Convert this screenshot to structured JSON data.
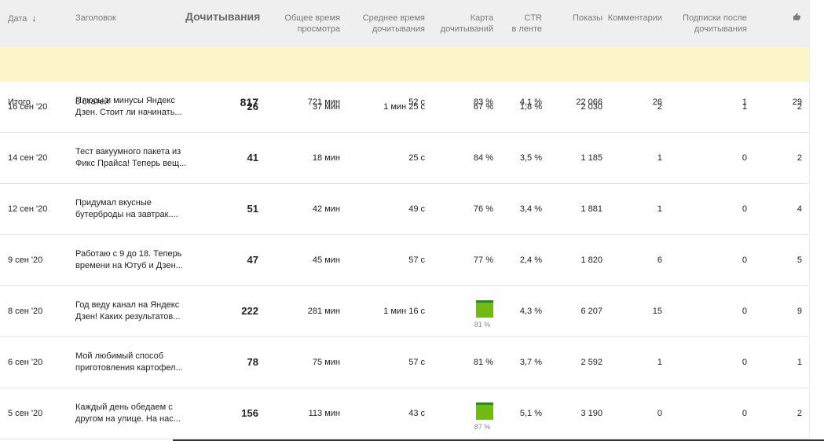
{
  "header": {
    "date": "Дата",
    "sort_arrow": "↓",
    "title": "Заголовок",
    "reads": "Дочитывания",
    "total_time_1": "Общее время",
    "total_time_2": "просмотра",
    "avg_time_1": "Среднее время",
    "avg_time_2": "дочитывания",
    "map_1": "Карта",
    "map_2": "дочитываний",
    "ctr_1": "CTR",
    "ctr_2": "в ленте",
    "shows": "Показы",
    "comments": "Комментарии",
    "subs_1": "Подписки после",
    "subs_2": "дочитывания",
    "likes_icon": "thumbs-up-icon"
  },
  "total": {
    "date": "Итого",
    "title": "8 статей",
    "reads": "817",
    "total_time": "721 мин",
    "avg_time": "52 с",
    "map": "83 %",
    "ctr": "4,1 %",
    "shows": "22 066",
    "comments": "26",
    "subs": "1",
    "likes": "29"
  },
  "rows": [
    {
      "date": "16 сен '20",
      "title_1": "Плюсы и минусы Яндекс",
      "title_2": "Дзен. Стоит ли начинать...",
      "reads": "26",
      "total_time": "37 мин",
      "avg_time": "1 мин 25 с",
      "map": "67 %",
      "map_bar": false,
      "ctr": "1,8 %",
      "shows": "2 030",
      "comments": "2",
      "subs": "1",
      "likes": "2"
    },
    {
      "date": "14 сен '20",
      "title_1": "Тест вакуумного пакета из",
      "title_2": "Фикс Прайса! Теперь вещ...",
      "reads": "41",
      "total_time": "18 мин",
      "avg_time": "25 с",
      "map": "84 %",
      "map_bar": false,
      "ctr": "3,5 %",
      "shows": "1 185",
      "comments": "1",
      "subs": "0",
      "likes": "2"
    },
    {
      "date": "12 сен '20",
      "title_1": "Придумал вкусные",
      "title_2": "бутерброды на завтрак....",
      "reads": "51",
      "total_time": "42 мин",
      "avg_time": "49 с",
      "map": "76 %",
      "map_bar": false,
      "ctr": "3,4 %",
      "shows": "1 881",
      "comments": "1",
      "subs": "0",
      "likes": "4"
    },
    {
      "date": "9 сен '20",
      "title_1": "Работаю с 9 до 18. Теперь",
      "title_2": "времени на Ютуб и Дзен...",
      "reads": "47",
      "total_time": "45 мин",
      "avg_time": "57 с",
      "map": "77 %",
      "map_bar": false,
      "ctr": "2,4 %",
      "shows": "1 820",
      "comments": "6",
      "subs": "0",
      "likes": "5"
    },
    {
      "date": "8 сен '20",
      "title_1": "Год веду канал на Яндекс",
      "title_2": "Дзен! Каких результатов...",
      "reads": "222",
      "total_time": "281 мин",
      "avg_time": "1 мин 16 с",
      "map": "81 %",
      "map_bar": true,
      "ctr": "4,3 %",
      "shows": "6 207",
      "comments": "15",
      "subs": "0",
      "likes": "9"
    },
    {
      "date": "6 сен '20",
      "title_1": "Мой любимый способ",
      "title_2": "приготовления картофел...",
      "reads": "78",
      "total_time": "75 мин",
      "avg_time": "57 с",
      "map": "81 %",
      "map_bar": false,
      "ctr": "3,7 %",
      "shows": "2 592",
      "comments": "1",
      "subs": "0",
      "likes": "1"
    },
    {
      "date": "5 сен '20",
      "title_1": "Каждый день обедаем с",
      "title_2": "другом на улице. На нас...",
      "reads": "156",
      "total_time": "113 мин",
      "avg_time": "43 с",
      "map": "87 %",
      "map_bar": true,
      "ctr": "5,1 %",
      "shows": "3 190",
      "comments": "0",
      "subs": "0",
      "likes": "2"
    }
  ]
}
